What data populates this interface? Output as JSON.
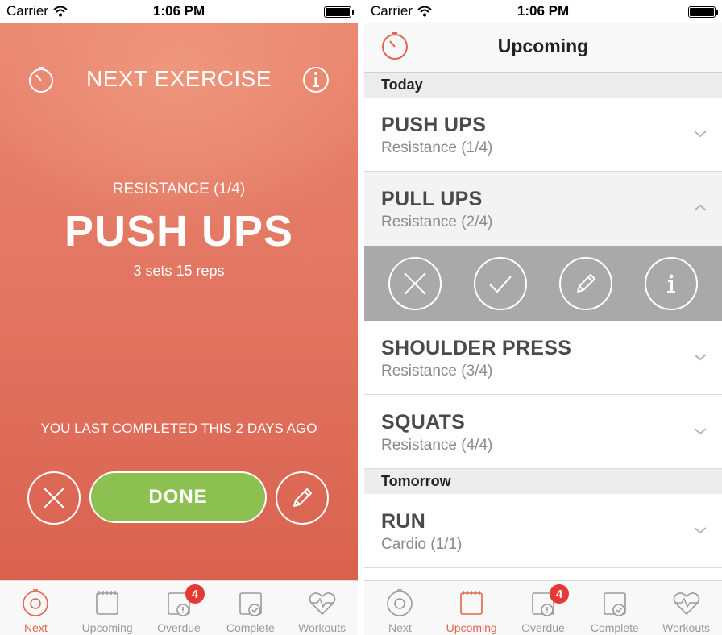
{
  "status_bar": {
    "carrier": "Carrier",
    "time": "1:06 PM"
  },
  "left": {
    "title": "NEXT EXERCISE",
    "category": "RESISTANCE (1/4)",
    "exercise": "PUSH UPS",
    "detail": "3 sets 15 reps",
    "last_completed": "YOU LAST COMPLETED THIS 2 DAYS AGO",
    "done_label": "DONE",
    "active_tab": "Next"
  },
  "right": {
    "title": "Upcoming",
    "sections": [
      {
        "label": "Today"
      },
      {
        "label": "Tomorrow"
      }
    ],
    "items": [
      {
        "name": "PUSH UPS",
        "sub": "Resistance (1/4)"
      },
      {
        "name": "PULL UPS",
        "sub": "Resistance (2/4)"
      },
      {
        "name": "SHOULDER PRESS",
        "sub": "Resistance (3/4)"
      },
      {
        "name": "SQUATS",
        "sub": "Resistance (4/4)"
      },
      {
        "name": "RUN",
        "sub": "Cardio (1/1)"
      }
    ],
    "active_tab": "Upcoming"
  },
  "tabs": [
    {
      "label": "Next",
      "icon": "timer-icon"
    },
    {
      "label": "Upcoming",
      "icon": "calendar-icon"
    },
    {
      "label": "Overdue",
      "icon": "calendar-alert-icon",
      "badge": "4"
    },
    {
      "label": "Complete",
      "icon": "calendar-check-icon"
    },
    {
      "label": "Workouts",
      "icon": "heart-pulse-icon"
    }
  ],
  "colors": {
    "accent": "#e2654f",
    "done_green": "#8cc152",
    "badge": "#e53935",
    "action_gray": "#a9a9a9"
  }
}
